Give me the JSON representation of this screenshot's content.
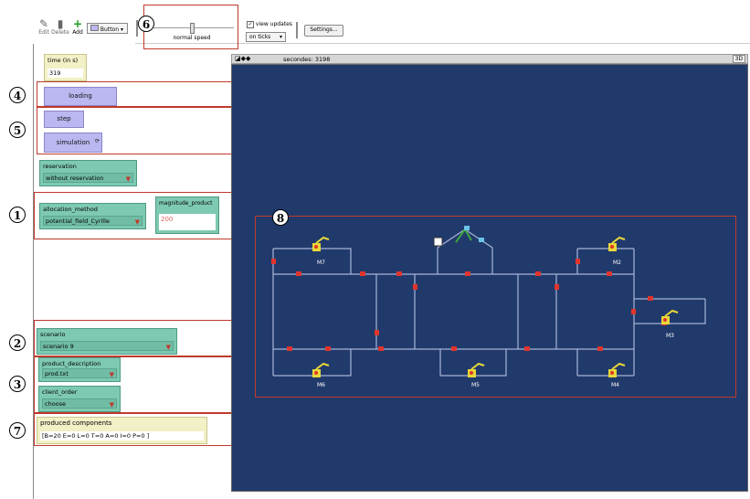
{
  "toolbar": {
    "edit_label": "Edit",
    "delete_label": "Delete",
    "add_label": "Add",
    "widget_type": "Button",
    "speed_label": "normal speed",
    "view_updates_label": "view updates",
    "update_mode": "on ticks",
    "settings_label": "Settings..."
  },
  "annotations": [
    "1",
    "2",
    "3",
    "4",
    "5",
    "6",
    "7",
    "8"
  ],
  "time_monitor": {
    "label": "time (in s)",
    "value": "319"
  },
  "buttons": {
    "loading": "loading",
    "step": "step",
    "simulation": "simulation"
  },
  "reservation": {
    "label": "reservation",
    "value": "without reservation"
  },
  "allocation_method": {
    "label": "allocation_method",
    "value": "potential_field_Cyrille"
  },
  "magnitude_product": {
    "label": "magnitude_product",
    "value": "200"
  },
  "scenario": {
    "label": "scenario",
    "value": "scenario 9"
  },
  "product_description": {
    "label": "product_description",
    "value": "prod.txt"
  },
  "client_order": {
    "label": "client_order",
    "value": "choose"
  },
  "produced_components": {
    "label": "produced components",
    "value": "[B=20  E=0  L=0  T=0  A=0  I=0  P=0 ]"
  },
  "view": {
    "title": "secondes: 3198",
    "three_d": "3D",
    "background": "#213a6c"
  },
  "machines": [
    "M7",
    "M2",
    "M3",
    "M6",
    "M5",
    "M4"
  ]
}
